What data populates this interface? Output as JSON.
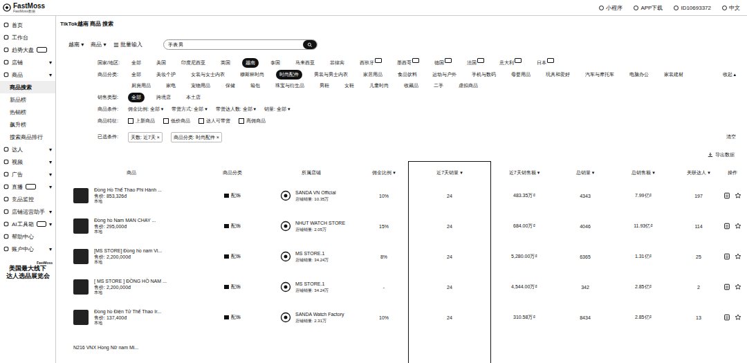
{
  "topbar": {
    "logo": "FastMoss",
    "logo_sub": "FastMoss数据",
    "actions": [
      "小程序",
      "APP下载",
      "ID10693372",
      "中文"
    ]
  },
  "sidebar": {
    "items": [
      {
        "label": "首页",
        "chevron": "",
        "badge": false,
        "expanded": false,
        "selected": false,
        "sub": false
      },
      {
        "label": "工作台",
        "chevron": "",
        "badge": false,
        "expanded": false,
        "selected": false,
        "sub": false
      },
      {
        "label": "趋势大盘",
        "chevron": "",
        "badge": true,
        "expanded": false,
        "selected": false,
        "sub": false
      },
      {
        "label": "店铺",
        "chevron": "▾",
        "badge": false,
        "expanded": false,
        "selected": false,
        "sub": false
      },
      {
        "label": "商品",
        "chevron": "▾",
        "badge": false,
        "expanded": true,
        "selected": false,
        "sub": false
      },
      {
        "label": "商品搜索",
        "chevron": "",
        "badge": false,
        "expanded": false,
        "selected": true,
        "sub": true
      },
      {
        "label": "新品榜",
        "chevron": "",
        "badge": false,
        "expanded": false,
        "selected": false,
        "sub": true
      },
      {
        "label": "热销榜",
        "chevron": "",
        "badge": false,
        "expanded": false,
        "selected": false,
        "sub": true
      },
      {
        "label": "飙升榜",
        "chevron": "",
        "badge": false,
        "expanded": false,
        "selected": false,
        "sub": true
      },
      {
        "label": "搜索商品排行",
        "chevron": "",
        "badge": false,
        "expanded": false,
        "selected": false,
        "sub": true
      },
      {
        "label": "达人",
        "chevron": "▾",
        "badge": false,
        "expanded": false,
        "selected": false,
        "sub": false
      },
      {
        "label": "视频",
        "chevron": "▾",
        "badge": false,
        "expanded": false,
        "selected": false,
        "sub": false
      },
      {
        "label": "广告",
        "chevron": "▾",
        "badge": false,
        "expanded": false,
        "selected": false,
        "sub": false
      },
      {
        "label": "直播",
        "chevron": "▾",
        "badge": true,
        "expanded": false,
        "selected": false,
        "sub": false
      },
      {
        "label": "竞品监控",
        "chevron": "",
        "badge": false,
        "expanded": false,
        "selected": false,
        "sub": false
      },
      {
        "label": "店铺运营助手",
        "chevron": "▾",
        "badge": false,
        "expanded": false,
        "selected": false,
        "sub": false
      },
      {
        "label": "AI工具箱",
        "chevron": "▾",
        "badge": true,
        "expanded": false,
        "selected": false,
        "sub": false
      },
      {
        "label": "帮助中心",
        "chevron": "",
        "badge": false,
        "expanded": false,
        "selected": false,
        "sub": false
      },
      {
        "label": "账户中心",
        "chevron": "▾",
        "badge": false,
        "expanded": false,
        "selected": false,
        "sub": false
      }
    ],
    "promo": {
      "badge": "FastMoss",
      "lines": [
        "美国最大线下",
        "达人选品展览会"
      ]
    }
  },
  "title": "TikTok越南 商品 搜索",
  "search": {
    "selects": [
      "越南 ▾",
      "商品 ▾"
    ],
    "batch": "批量输入",
    "value": "手表 男"
  },
  "filters": {
    "country": {
      "label": "国家/地区:",
      "items": [
        {
          "label": "全部",
          "selected": false,
          "badge": false
        },
        {
          "label": "美国",
          "selected": false,
          "badge": false
        },
        {
          "label": "印度尼西亚",
          "selected": false,
          "badge": false
        },
        {
          "label": "英国",
          "selected": false,
          "badge": false
        },
        {
          "label": "越南",
          "selected": true,
          "badge": false
        },
        {
          "label": "泰国",
          "selected": false,
          "badge": false
        },
        {
          "label": "马来西亚",
          "selected": false,
          "badge": false
        },
        {
          "label": "菲律宾",
          "selected": false,
          "badge": false
        },
        {
          "label": "西班牙",
          "selected": false,
          "badge": true
        },
        {
          "label": "墨西哥",
          "selected": false,
          "badge": true
        },
        {
          "label": "德国",
          "selected": false,
          "badge": true
        },
        {
          "label": "法国",
          "selected": false,
          "badge": true
        },
        {
          "label": "意大利",
          "selected": false,
          "badge": true
        },
        {
          "label": "日本",
          "selected": false,
          "badge": true
        }
      ]
    },
    "category": {
      "label": "商品分类:",
      "collapse": "收起 ▴",
      "items": [
        {
          "label": "全部",
          "selected": false
        },
        {
          "label": "美妆个护",
          "selected": false
        },
        {
          "label": "女装与女士内衣",
          "selected": false
        },
        {
          "label": "穆斯林时尚",
          "selected": false
        },
        {
          "label": "时尚配件",
          "selected": true
        },
        {
          "label": "男装与男士内衣",
          "selected": false
        },
        {
          "label": "家居用品",
          "selected": false
        },
        {
          "label": "食品饮料",
          "selected": false
        },
        {
          "label": "运动与户外",
          "selected": false
        },
        {
          "label": "手机与数码",
          "selected": false
        },
        {
          "label": "母婴用品",
          "selected": false
        },
        {
          "label": "玩具和爱好",
          "selected": false
        },
        {
          "label": "汽车与摩托车",
          "selected": false
        },
        {
          "label": "电脑办公",
          "selected": false
        },
        {
          "label": "家装建材",
          "selected": false
        },
        {
          "label": "厨房用品",
          "selected": false
        },
        {
          "label": "家电",
          "selected": false
        },
        {
          "label": "宠物用品",
          "selected": false
        },
        {
          "label": "保健",
          "selected": false
        },
        {
          "label": "箱包",
          "selected": false
        },
        {
          "label": "珠宝与衍生品",
          "selected": false
        },
        {
          "label": "男鞋",
          "selected": false
        },
        {
          "label": "女鞋",
          "selected": false
        },
        {
          "label": "儿童时尚",
          "selected": false
        },
        {
          "label": "收藏品",
          "selected": false
        },
        {
          "label": "二手",
          "selected": false
        },
        {
          "label": "虚拟商品",
          "selected": false
        }
      ]
    },
    "sales_type": {
      "label": "销售类型:",
      "items": [
        {
          "label": "全部",
          "selected": true
        },
        {
          "label": "跨境店",
          "selected": false
        },
        {
          "label": "本土店",
          "selected": false
        }
      ]
    },
    "conditions": {
      "label": "商品条件:",
      "items": [
        "佣金比例: 全部 ▾",
        "带货方式: 全部 ▾",
        "带货达人数: 全部 ▾",
        "销量: 全部 ▾"
      ]
    },
    "features": {
      "label": "商品特征:",
      "items": [
        {
          "label": "上新商品",
          "checked": false
        },
        {
          "label": "低价商品",
          "checked": false
        },
        {
          "label": "达人可带货",
          "checked": false
        },
        {
          "label": "高佣商品",
          "checked": false
        }
      ]
    },
    "chosen": {
      "label": "已选条件:",
      "chips": [
        "天数: 近7天 ×",
        "商品分类: 时尚配件 ×"
      ],
      "clear": "清空"
    }
  },
  "export": "导出数据",
  "table": {
    "columns": [
      {
        "key": "product",
        "label": "商品",
        "highlighted": false
      },
      {
        "key": "category",
        "label": "商品分类",
        "highlighted": false
      },
      {
        "key": "shop",
        "label": "所属店铺",
        "highlighted": false
      },
      {
        "key": "commission",
        "label": "佣金比例 ▾",
        "highlighted": false
      },
      {
        "key": "sales7",
        "label": "近7天销量 ▾",
        "highlighted": true
      },
      {
        "key": "revenue7",
        "label": "近7天销售额 ▾",
        "highlighted": false
      },
      {
        "key": "total_sales",
        "label": "总销量 ▾",
        "highlighted": false
      },
      {
        "key": "total_revenue",
        "label": "总销售额 ▾",
        "highlighted": false
      },
      {
        "key": "creators",
        "label": "关联达人 ▾",
        "highlighted": false
      },
      {
        "key": "ops",
        "label": "操作",
        "highlighted": false
      }
    ],
    "rows": [
      {
        "title": "Đồng Hồ Thể Thao Phi Hành ...",
        "price": "售价: 853,326đ",
        "tag": "本地",
        "category": "配饰",
        "shop": "SANDA VN Official",
        "shop_sales": "店铺销量: 10.35万",
        "commission": "10%",
        "sales7": "24",
        "revenue7": "483.35万₫",
        "total_sales": "4343",
        "total_revenue": "7.99亿₫",
        "creators": "197"
      },
      {
        "title": "Đồng hồ Nam MAN CHAY ...",
        "price": "售价: 295,000đ",
        "tag": "本地",
        "category": "配饰",
        "shop": "NHUT WATCH STORE",
        "shop_sales": "店铺销量: 2.05万",
        "commission": "15%",
        "sales7": "24",
        "revenue7": "684.00万₫",
        "total_sales": "4046",
        "total_revenue": "11.93亿₫",
        "creators": "114"
      },
      {
        "title": "[MS STORE] Đồng hồ nam Vi...",
        "price": "售价: 2,200,000đ",
        "tag": "本地",
        "category": "配饰",
        "shop": "MS STORE.1",
        "shop_sales": "店铺销量: 34.24万",
        "commission": "8%",
        "sales7": "24",
        "revenue7": "5,280.00万₫",
        "total_sales": "6365",
        "total_revenue": "1.31亿₫",
        "creators": "25"
      },
      {
        "title": "[ MS STORE ] ĐỒNG HỒ NAM ...",
        "price": "售价: 2,200,000đ",
        "tag": "本地",
        "category": "配饰",
        "shop": "MS STORE.1",
        "shop_sales": "店铺销量: 34.24万",
        "commission": "-",
        "sales7": "24",
        "revenue7": "4,544.00万₫",
        "total_sales": "342",
        "total_revenue": "2.85亿₫",
        "creators": "2"
      },
      {
        "title": "Đồng hồ Điện Tử Thể Thao Ir...",
        "price": "售价: 137,400đ",
        "tag": "本地",
        "category": "配饰",
        "shop": "SANDA Watch Factory",
        "shop_sales": "店铺销量: 2.31万",
        "commission": "10%",
        "sales7": "24",
        "revenue7": "310.58万₫",
        "total_sales": "8434",
        "total_revenue": "2.85亿₫",
        "creators": "13"
      },
      {
        "title": "N216 VNX Hồng Nữ nam Mi..."
      }
    ]
  }
}
